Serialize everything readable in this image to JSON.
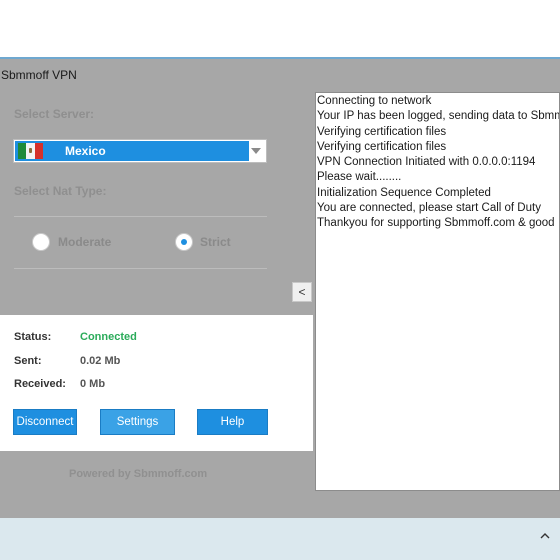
{
  "window": {
    "title": "Sbmmoff VPN"
  },
  "server": {
    "label": "Select Server:",
    "selected": "Mexico",
    "flag_icon": "mexico-flag-icon"
  },
  "nat": {
    "label": "Select Nat Type:",
    "options": [
      {
        "label": "Moderate",
        "selected": false
      },
      {
        "label": "Strict",
        "selected": true
      }
    ]
  },
  "collapse_button": {
    "glyph": "<"
  },
  "log": {
    "lines": [
      "Connecting to network",
      "Your IP has been logged, sending data to Sbmm",
      "Verifying certification files",
      "Verifying certification files",
      "VPN Connection Initiated with 0.0.0.0:1194",
      "Please wait........",
      "Initialization Sequence Completed",
      "You are connected, please start Call of Duty",
      "Thankyou for supporting Sbmmoff.com & good"
    ]
  },
  "status": {
    "status_label": "Status:",
    "status_value": "Connected",
    "sent_label": "Sent:",
    "sent_value": "0.02 Mb",
    "received_label": "Received:",
    "received_value": "0 Mb"
  },
  "buttons": {
    "disconnect": "Disconnect",
    "settings": "Settings",
    "help": "Help"
  },
  "footer": {
    "powered_by": "Powered by Sbmmoff.com"
  },
  "colors": {
    "accent": "#1e8fe0",
    "connected": "#2bab5a",
    "window_bg": "#a7a7a7"
  }
}
